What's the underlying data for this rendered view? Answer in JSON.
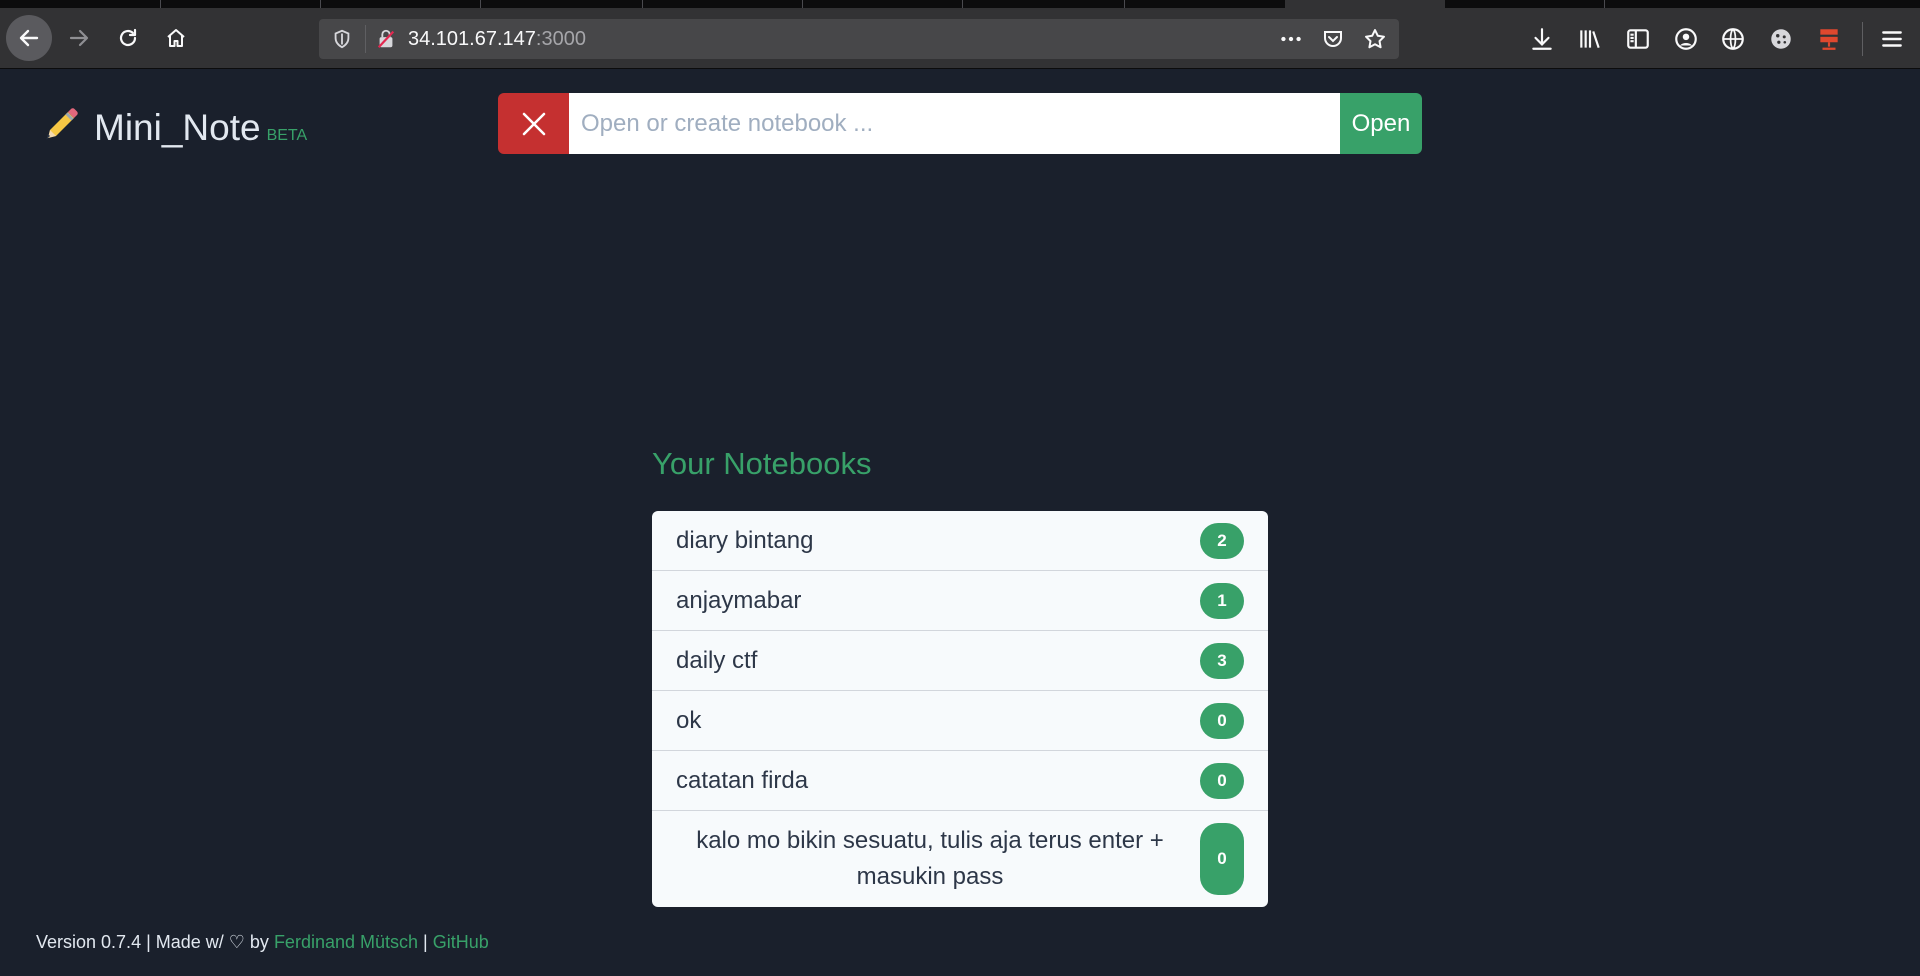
{
  "browser": {
    "url_host": "34.101.67.147",
    "url_port": ":3000"
  },
  "app": {
    "title": "Mini_Note",
    "badge": "BETA"
  },
  "search": {
    "placeholder": "Open or create notebook ...",
    "value": "",
    "open_label": "Open"
  },
  "notebooks": {
    "heading": "Your Notebooks",
    "items": [
      {
        "name": "diary bintang",
        "count": "2"
      },
      {
        "name": "anjaymabar",
        "count": "1"
      },
      {
        "name": "daily ctf",
        "count": "3"
      },
      {
        "name": "ok",
        "count": "0"
      },
      {
        "name": "catatan firda",
        "count": "0"
      },
      {
        "name": "kalo mo bikin sesuatu, tulis aja terus enter + masukin pass",
        "count": "0"
      }
    ]
  },
  "footer": {
    "prefix": "Version 0.7.4 | Made w/ ♡ by ",
    "author": "Ferdinand Mütsch",
    "separator": " | ",
    "github": "GitHub"
  },
  "colors": {
    "background": "#1a202c",
    "accent_green": "#38a169",
    "danger_red": "#c53030"
  }
}
